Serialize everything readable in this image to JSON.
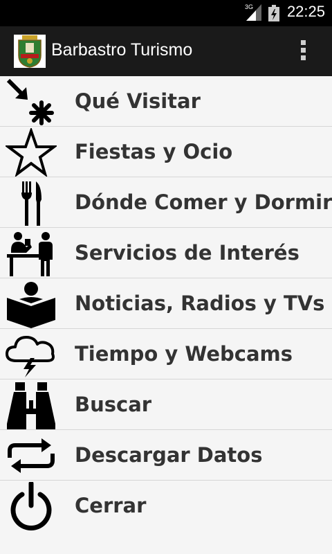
{
  "status_bar": {
    "network": "3G",
    "time": "22:25",
    "signal_icon": "signal-icon",
    "battery_icon": "battery-icon"
  },
  "action_bar": {
    "title": "Barbastro Turismo",
    "logo_icon": "coat-of-arms-icon",
    "overflow_icon": "overflow-menu-icon"
  },
  "menu": {
    "items": [
      {
        "label": "Qué Visitar",
        "icon": "visit-arrow-star-icon"
      },
      {
        "label": "Fiestas y Ocio",
        "icon": "star-outline-icon"
      },
      {
        "label": "Dónde Comer y Dormir",
        "icon": "fork-knife-icon"
      },
      {
        "label": "Servicios de Interés",
        "icon": "service-desk-icon"
      },
      {
        "label": "Noticias, Radios y TVs",
        "icon": "reader-book-icon"
      },
      {
        "label": "Tiempo y Webcams",
        "icon": "storm-cloud-icon"
      },
      {
        "label": "Buscar",
        "icon": "binoculars-icon"
      },
      {
        "label": "Descargar Datos",
        "icon": "sync-arrows-icon"
      },
      {
        "label": "Cerrar",
        "icon": "power-icon"
      }
    ]
  }
}
